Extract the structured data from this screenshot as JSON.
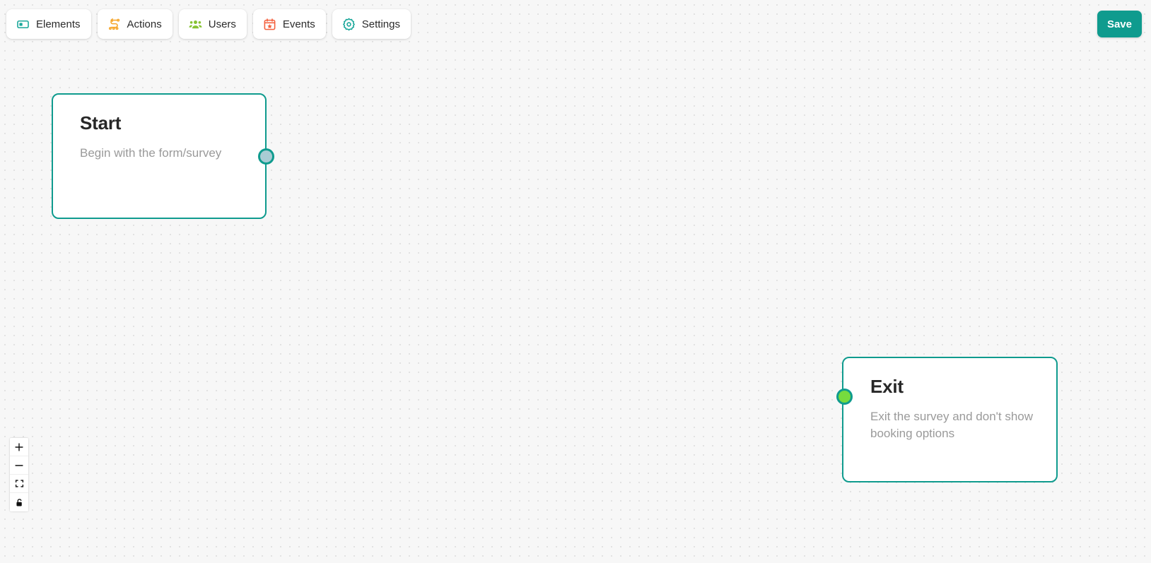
{
  "toolbar": {
    "buttons": [
      {
        "label": "Elements",
        "icon": "elements-icon",
        "color": "#1aa79a"
      },
      {
        "label": "Actions",
        "icon": "actions-icon",
        "color": "#f6a62b"
      },
      {
        "label": "Users",
        "icon": "users-icon",
        "color": "#86c232"
      },
      {
        "label": "Events",
        "icon": "events-icon",
        "color": "#f4603e"
      },
      {
        "label": "Settings",
        "icon": "gear-icon",
        "color": "#1aa79a"
      }
    ],
    "save_label": "Save",
    "save_color": "#0f9b8e"
  },
  "canvas": {
    "nodes": [
      {
        "id": "start",
        "title": "Start",
        "description": "Begin with the form/survey",
        "border_color": "#0f9b8e",
        "handle": {
          "type": "source",
          "color": "#a9ccd4"
        }
      },
      {
        "id": "exit",
        "title": "Exit",
        "description": "Exit the survey and don't show booking options",
        "border_color": "#0f9b8e",
        "handle": {
          "type": "target",
          "color": "#76db3e"
        }
      }
    ]
  },
  "controls": {
    "buttons": [
      {
        "name": "zoom-in",
        "glyph": "+"
      },
      {
        "name": "zoom-out",
        "glyph": "−"
      },
      {
        "name": "fit-view",
        "glyph": "fit"
      },
      {
        "name": "lock",
        "glyph": "unlocked-padlock"
      }
    ]
  }
}
